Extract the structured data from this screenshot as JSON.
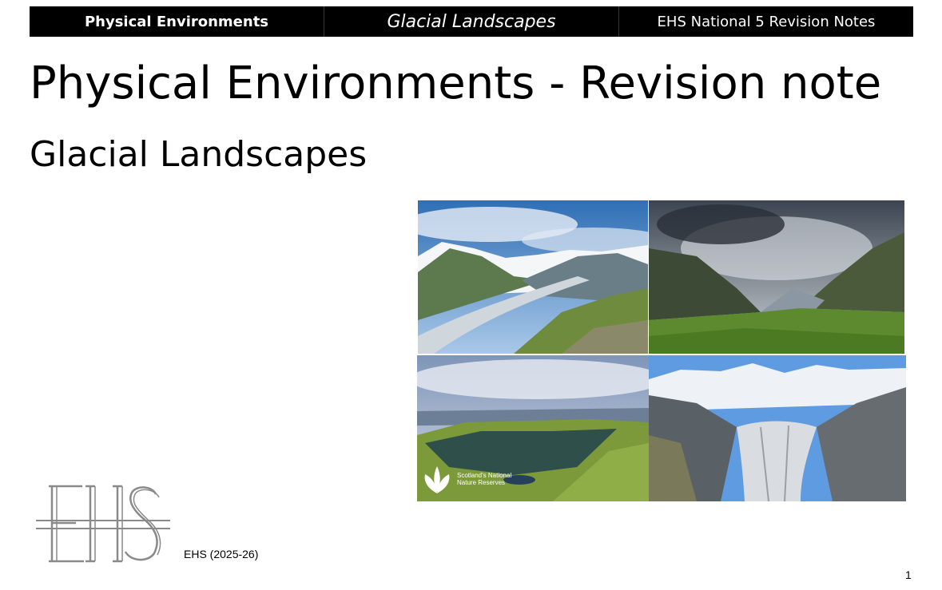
{
  "header": {
    "left_label": "Physical Environments",
    "center_label": "Glacial Landscapes",
    "right_label": "EHS National 5 Revision Notes"
  },
  "title": "Physical Environments - Revision note",
  "subtitle": "Glacial Landscapes",
  "photos": {
    "badge_text": "Scotland's National Nature Reserves"
  },
  "logo": {
    "text": "EHS"
  },
  "footer": {
    "credit": "EHS (2025-26)",
    "page_number": "1"
  }
}
